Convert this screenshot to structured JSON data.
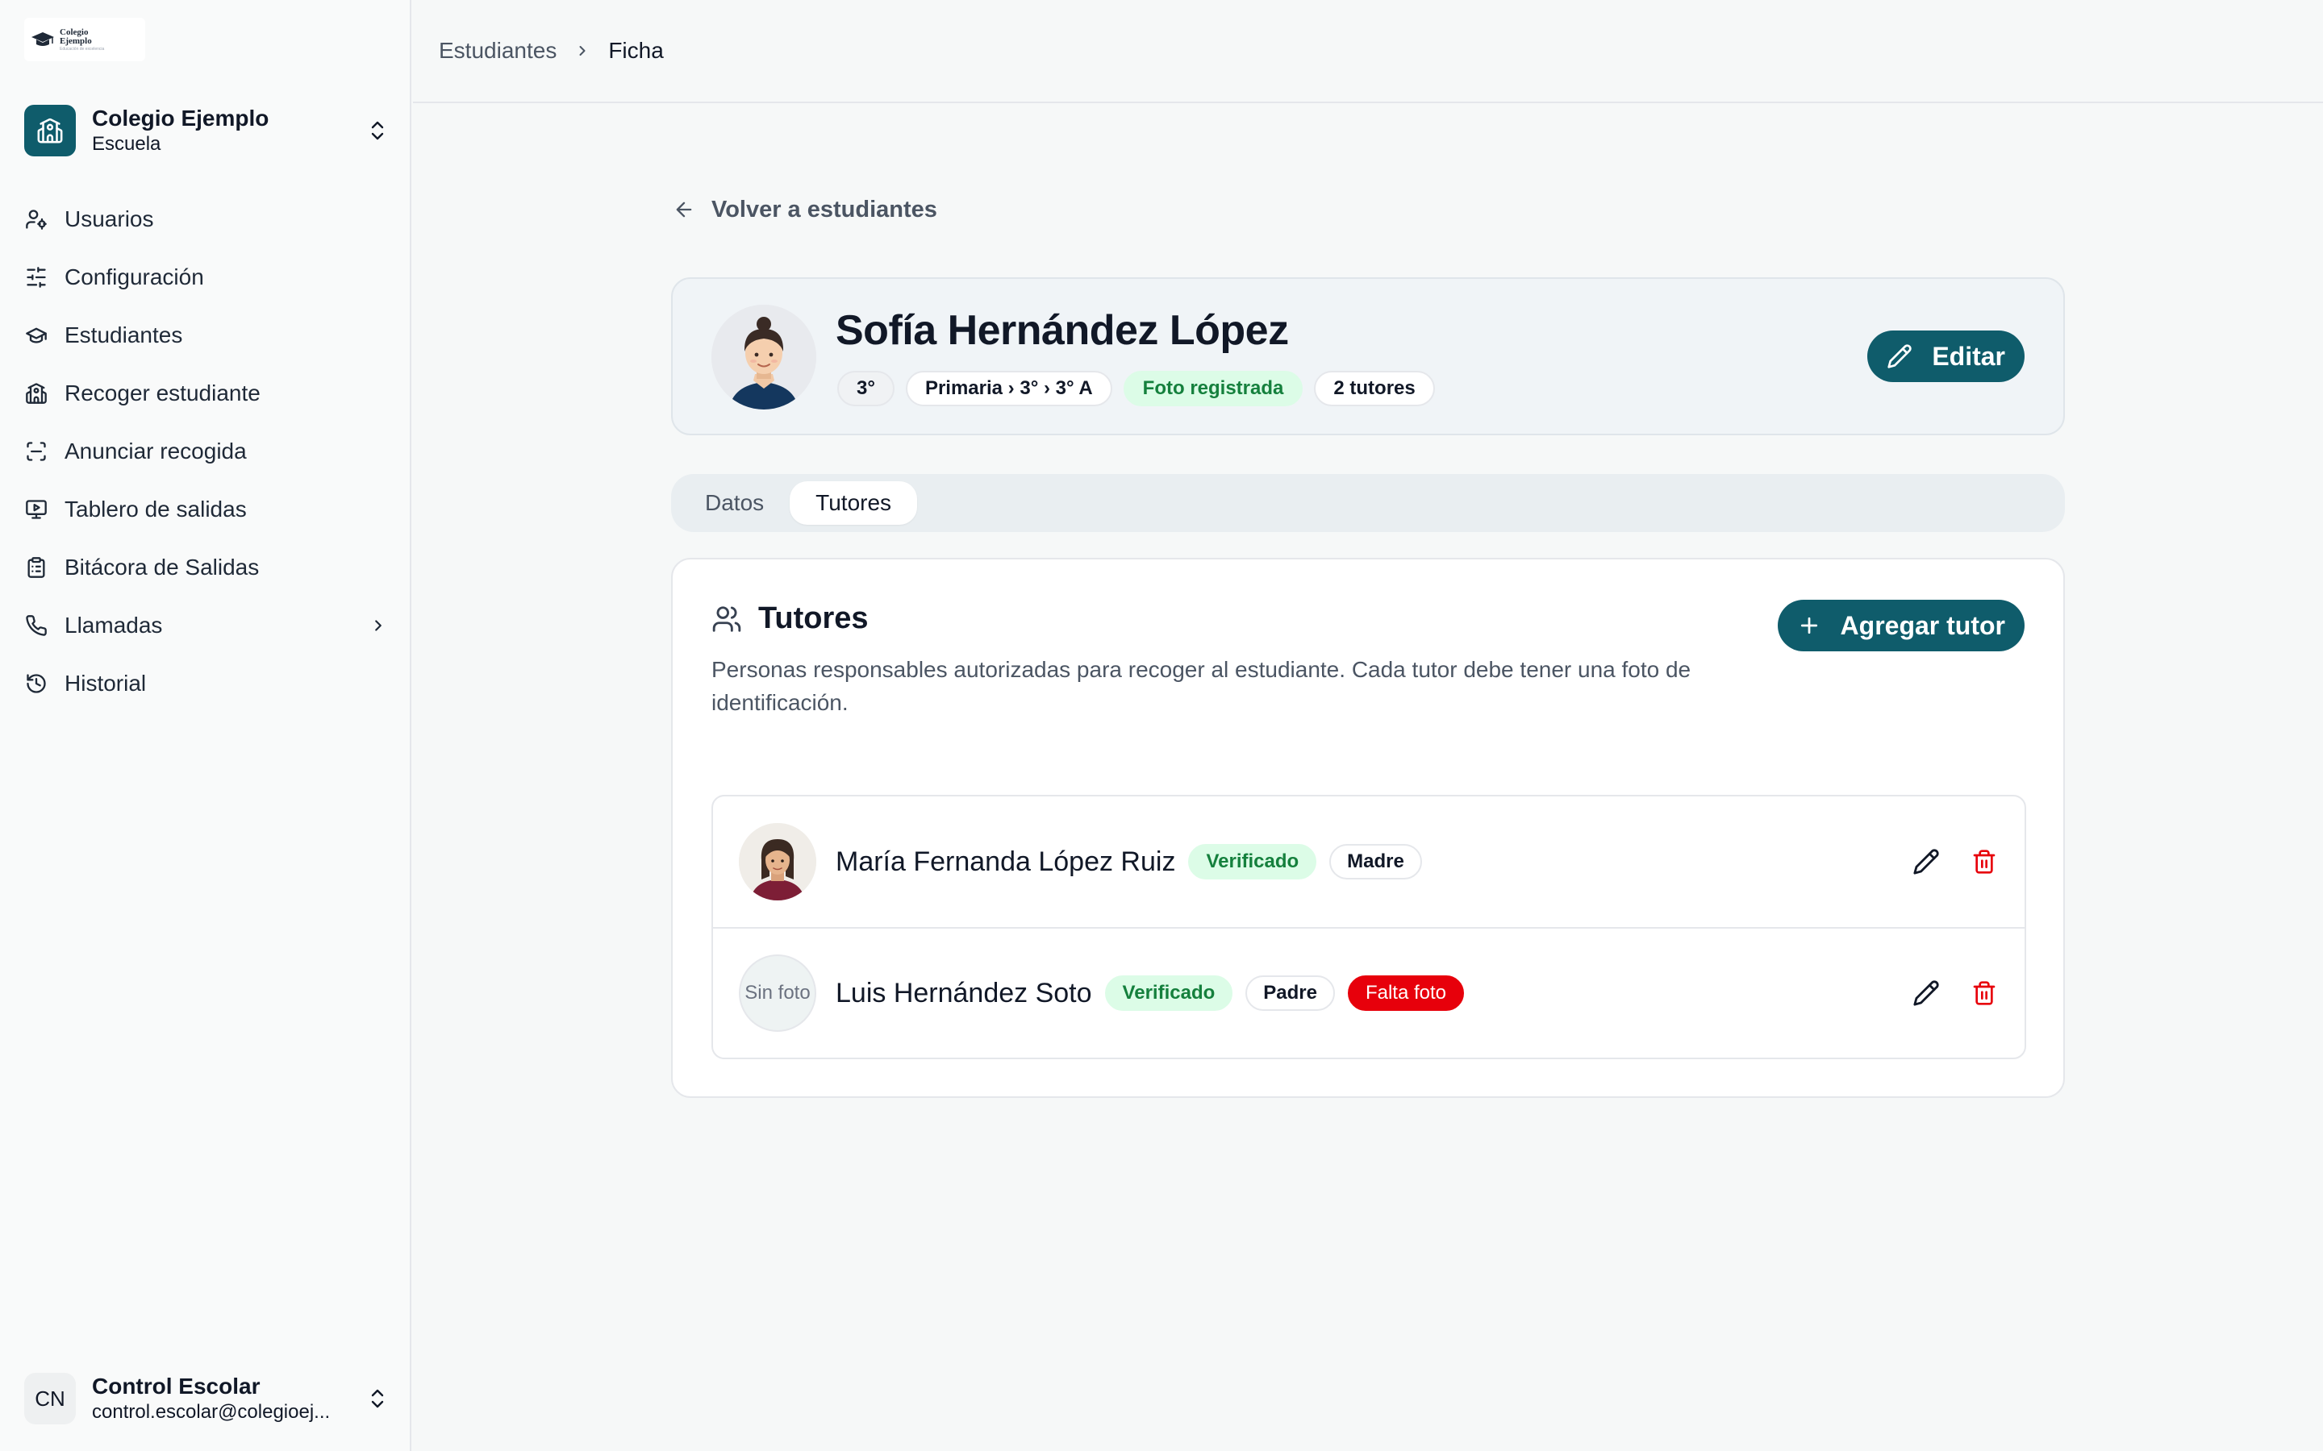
{
  "sidebar": {
    "logo": {
      "line1": "Colegio",
      "line2": "Ejemplo",
      "tagline": "Educación de excelencia"
    },
    "org": {
      "name": "Colegio Ejemplo",
      "type": "Escuela"
    },
    "nav": [
      {
        "label": "Usuarios",
        "icon": "users-cog-icon"
      },
      {
        "label": "Configuración",
        "icon": "sliders-icon"
      },
      {
        "label": "Estudiantes",
        "icon": "graduation-cap-icon"
      },
      {
        "label": "Recoger estudiante",
        "icon": "school-icon"
      },
      {
        "label": "Anunciar recogida",
        "icon": "scan-icon"
      },
      {
        "label": "Tablero de salidas",
        "icon": "monitor-play-icon"
      },
      {
        "label": "Bitácora de Salidas",
        "icon": "clipboard-list-icon"
      },
      {
        "label": "Llamadas",
        "icon": "phone-icon"
      },
      {
        "label": "Historial",
        "icon": "history-icon"
      }
    ],
    "user": {
      "initials": "CN",
      "name": "Control Escolar",
      "email": "control.escolar@colegioej..."
    }
  },
  "breadcrumb": {
    "parent": "Estudiantes",
    "current": "Ficha"
  },
  "back_label": "Volver a estudiantes",
  "student": {
    "name": "Sofía Hernández López",
    "chips": {
      "grade": "3°",
      "path": "Primaria › 3° › 3° A",
      "photo": "Foto registrada",
      "tutors": "2 tutores"
    },
    "edit_label": "Editar"
  },
  "tabs": {
    "datos": "Datos",
    "tutores": "Tutores",
    "active": "Tutores"
  },
  "tutors_panel": {
    "title": "Tutores",
    "description": "Personas responsables autorizadas para recoger al estudiante. Cada tutor debe tener una foto de identificación.",
    "add_label": "Agregar tutor",
    "rows": [
      {
        "name": "María Fernanda López Ruiz",
        "status": "Verificado",
        "relation": "Madre",
        "photo": true
      },
      {
        "name": "Luis Hernández Soto",
        "status": "Verificado",
        "relation": "Padre",
        "photo": false,
        "no_photo_label": "Sin foto",
        "warning": "Falta foto"
      }
    ]
  },
  "colors": {
    "primary": "#0f5c6b",
    "success_bg": "#dcfce7",
    "success_fg": "#15803d",
    "danger": "#e7000b"
  }
}
